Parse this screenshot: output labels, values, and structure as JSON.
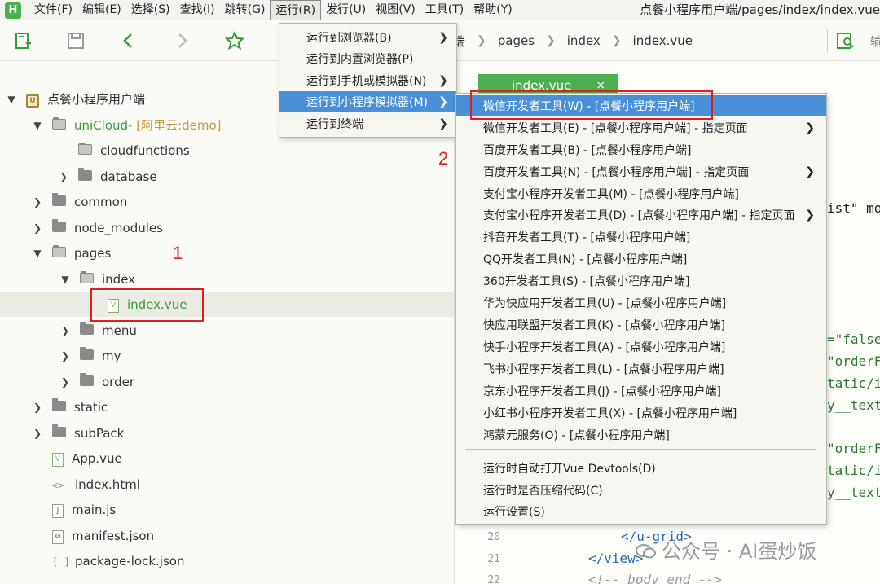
{
  "menubar": {
    "logo": "H",
    "items": [
      "文件(F)",
      "编辑(E)",
      "选择(S)",
      "查找(I)",
      "跳转(G)",
      "运行(R)",
      "发行(U)",
      "视图(V)",
      "工具(T)",
      "帮助(Y)"
    ],
    "window_title": "点餐小程序用户端/pages/index/index.vue"
  },
  "toolbar": {
    "icons": [
      "new-file-icon",
      "save-icon",
      "back-icon",
      "forward-icon",
      "star-icon",
      "search-icon"
    ]
  },
  "breadcrumb": {
    "items": [
      "端",
      "pages",
      "index",
      "index.vue"
    ],
    "search_hint": "输"
  },
  "tree": {
    "project": "点餐小程序用户端",
    "unicloud": "uniCloud",
    "unicloud_hint": " - [阿里云:demo]",
    "rows": [
      "cloudfunctions",
      "database",
      "common",
      "node_modules",
      "pages",
      "index",
      "index.vue",
      "menu",
      "my",
      "order",
      "static",
      "subPack",
      "App.vue",
      "index.html",
      "main.js",
      "manifest.json",
      "package-lock.json"
    ]
  },
  "annotations": {
    "one": "1",
    "two": "2"
  },
  "editor": {
    "tab_label": "index.vue",
    "tab_close": "×",
    "snippets": [
      "ist\" mo",
      "=\"false",
      "\"orderF",
      "tatic/i",
      "y__text",
      "\"orderF",
      "tatic/i",
      "y__text"
    ],
    "line_numbers": [
      "20",
      "21",
      "22"
    ],
    "code_20": "</u-grid>",
    "code_21": "</view>",
    "code_22": "<!-- body end -->"
  },
  "run_menu": {
    "items": [
      {
        "label": "运行到浏览器(B)",
        "submenu": true
      },
      {
        "label": "运行到内置浏览器(P)",
        "submenu": false
      },
      {
        "label": "运行到手机或模拟器(N)",
        "submenu": true
      },
      {
        "label": "运行到小程序模拟器(M)",
        "submenu": true,
        "highlighted": true
      },
      {
        "label": "运行到终端",
        "submenu": true
      }
    ]
  },
  "sub_menu": {
    "items": [
      {
        "label": "微信开发者工具(W) - [点餐小程序用户端]",
        "highlighted": true
      },
      {
        "label": "微信开发者工具(E) - [点餐小程序用户端] - 指定页面",
        "submenu": true
      },
      {
        "label": "百度开发者工具(B) - [点餐小程序用户端]"
      },
      {
        "label": "百度开发者工具(N) - [点餐小程序用户端] - 指定页面",
        "submenu": true
      },
      {
        "label": "支付宝小程序开发者工具(M) - [点餐小程序用户端]"
      },
      {
        "label": "支付宝小程序开发者工具(D) - [点餐小程序用户端] - 指定页面",
        "submenu": true
      },
      {
        "label": "抖音开发者工具(T) - [点餐小程序用户端]"
      },
      {
        "label": "QQ开发者工具(N) - [点餐小程序用户端]"
      },
      {
        "label": "360开发者工具(S) - [点餐小程序用户端]"
      },
      {
        "label": "华为快应用开发者工具(U) - [点餐小程序用户端]"
      },
      {
        "label": "快应用联盟开发者工具(K) - [点餐小程序用户端]"
      },
      {
        "label": "快手小程序开发者工具(A) - [点餐小程序用户端]"
      },
      {
        "label": "飞书小程序开发者工具(L) - [点餐小程序用户端]"
      },
      {
        "label": "京东小程序开发者工具(J) - [点餐小程序用户端]"
      },
      {
        "label": "小红书小程序开发者工具(X) - [点餐小程序用户端]"
      },
      {
        "label": "鸿蒙元服务(O) - [点餐小程序用户端]"
      },
      {
        "label": "运行时自动打开Vue Devtools(D)"
      },
      {
        "label": "运行时是否压缩代码(C)"
      },
      {
        "label": "运行设置(S)"
      }
    ]
  },
  "watermark": "公众号 · AI蛋炒饭",
  "colors": {
    "accent_green": "#4caf50",
    "highlight_blue": "#4a90d9",
    "annotation_red": "#e02020"
  }
}
